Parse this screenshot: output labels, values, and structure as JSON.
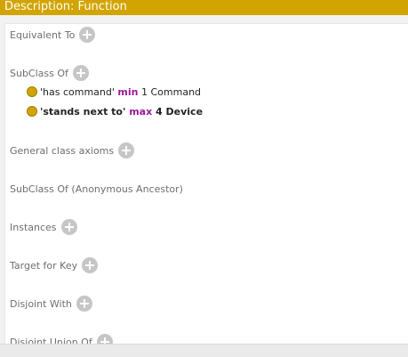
{
  "header": {
    "title": "Description: Function"
  },
  "sections": [
    {
      "label": "Equivalent To"
    },
    {
      "label": "SubClass Of"
    },
    {
      "label": "General class axioms"
    },
    {
      "label": "SubClass Of (Anonymous Ancestor)"
    },
    {
      "label": "Instances"
    },
    {
      "label": "Target for Key"
    },
    {
      "label": "Disjoint With"
    },
    {
      "label": "Disjoint Union Of"
    }
  ],
  "axioms": [
    {
      "property": "'has command'",
      "restriction": "min",
      "cardinality": "1",
      "filler": "Command"
    },
    {
      "property": "'stands next to'",
      "restriction": "max",
      "cardinality": "4",
      "filler": "Device"
    }
  ],
  "colors": {
    "accent": "#d2a400",
    "keyword": "#9b1a9b",
    "section_text": "#6f6f6f",
    "add_button": "#c6c6c6"
  },
  "icons": {
    "add": "plus-circle-icon",
    "axiom_marker": "class-dot-icon"
  }
}
